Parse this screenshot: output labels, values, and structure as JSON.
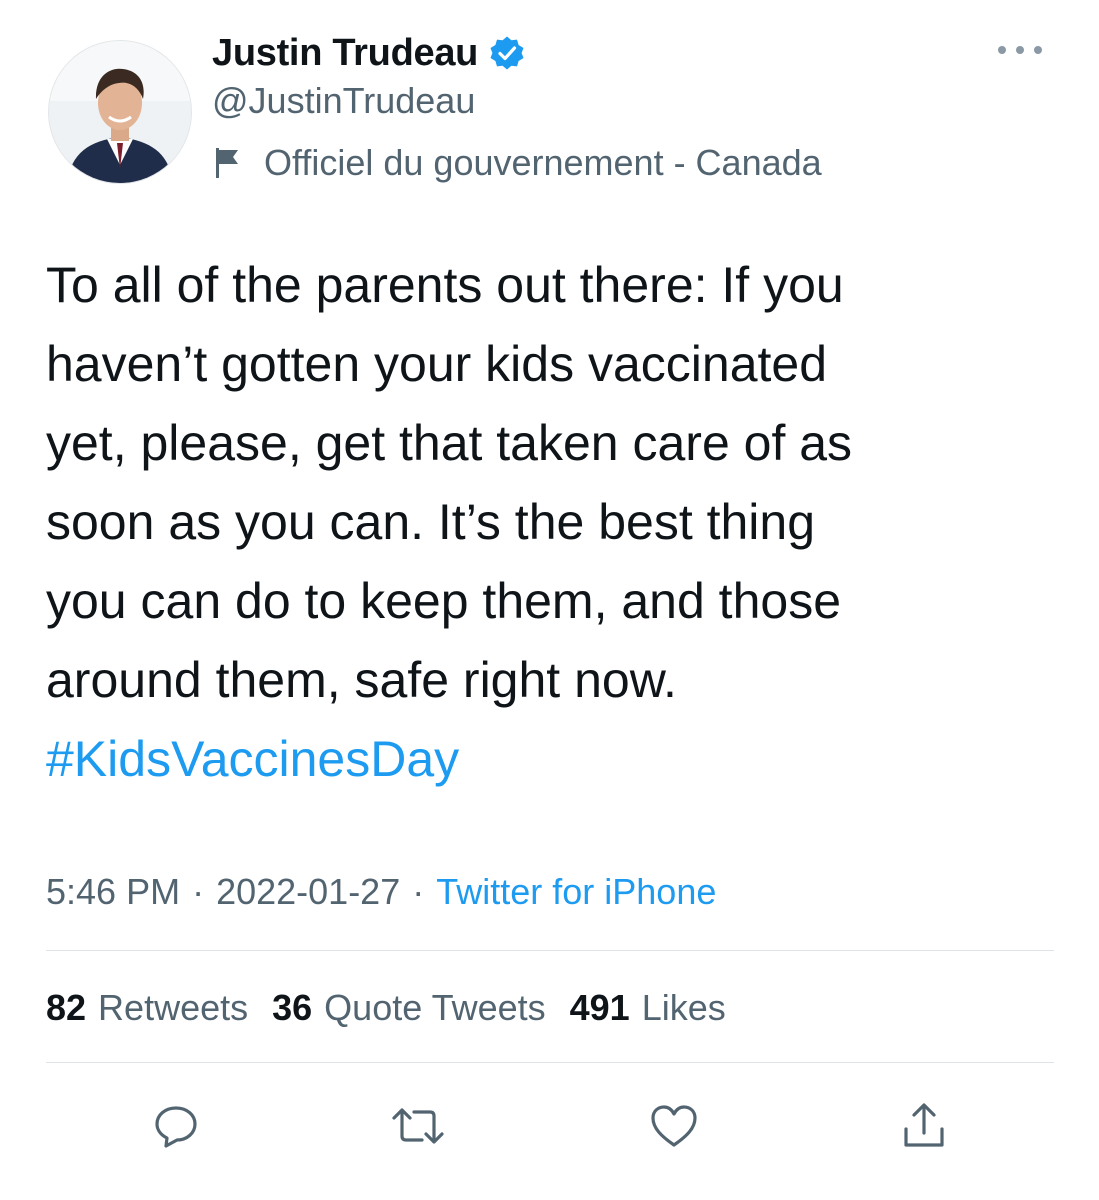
{
  "author": {
    "display_name": "Justin Trudeau",
    "handle": "@JustinTrudeau",
    "label": "Officiel du gouvernement - Canada",
    "verified_color": "#1d9bf0"
  },
  "tweet": {
    "lines": [
      "To all of the parents out there: If you",
      "haven’t gotten your kids vaccinated",
      "yet, please, get that taken care of as",
      "soon as you can. It’s the best thing",
      "you can do to keep them, and those",
      "around them, safe right now."
    ],
    "hashtag": "#KidsVaccinesDay",
    "time": "5:46 PM",
    "separator": "·",
    "date": "2022-01-27",
    "source": "Twitter for iPhone"
  },
  "stats": {
    "retweets": {
      "count": "82",
      "label": "Retweets"
    },
    "quotes": {
      "count": "36",
      "label": "Quote Tweets"
    },
    "likes": {
      "count": "491",
      "label": "Likes"
    }
  },
  "icons": {
    "verified": "verified-badge-icon",
    "flag": "flag-icon",
    "more": "more-options-icon",
    "reply": "reply-icon",
    "retweet": "retweet-icon",
    "like": "heart-icon",
    "share": "share-icon"
  },
  "colors": {
    "text": "#0f1419",
    "secondary": "#536471",
    "link": "#1d9bf0",
    "divider": "#dfe3e6"
  }
}
